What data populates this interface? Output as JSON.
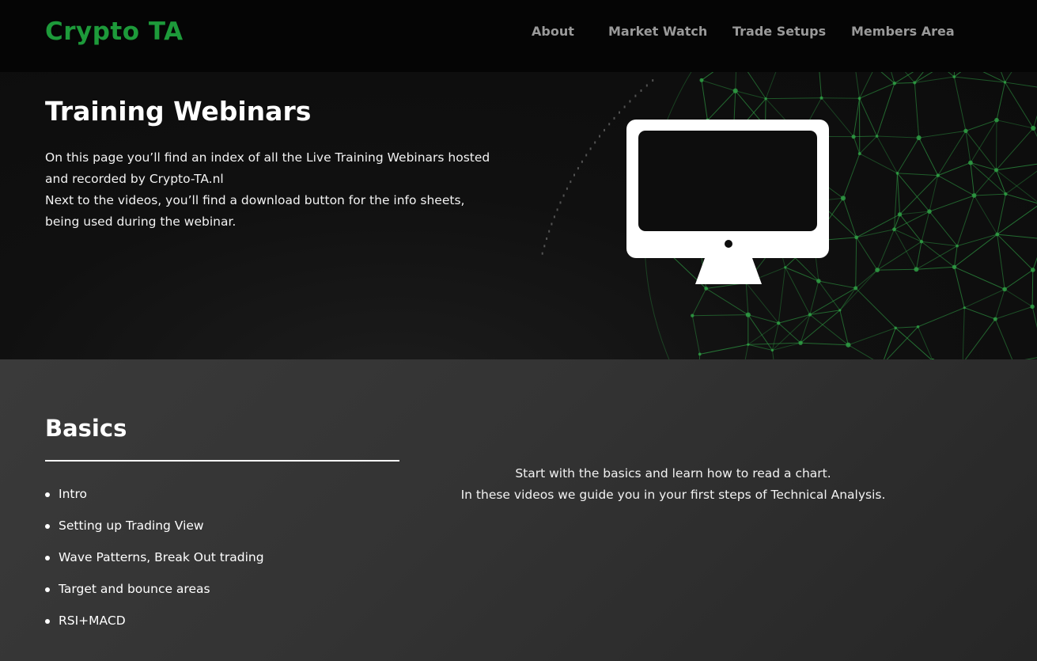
{
  "header": {
    "brand": "Crypto TA",
    "nav": [
      "About",
      "Market Watch",
      "Trade Setups",
      "Members Area"
    ]
  },
  "hero": {
    "title": "Training Webinars",
    "paragraph_1": "On this page you’ll find an index of all the Live Training Webinars hosted and recorded by Crypto-TA.nl",
    "paragraph_2": "Next to the videos, you’ll find a download button for the info sheets, being used during the webinar.",
    "icon": "monitor-icon",
    "background": "green-network-globe"
  },
  "basics": {
    "title": "Basics",
    "lessons": [
      "Intro",
      "Setting up Trading View",
      "Wave Patterns, Break Out trading",
      "Target and bounce areas",
      "RSI+MACD"
    ],
    "description_1": "Start with the basics and learn how to read a chart.",
    "description_2": "In these videos we guide you in your first steps of Technical Analysis."
  },
  "colors": {
    "brand_green": "#1d9a3a",
    "network_green": "#2f9e44",
    "nav_text": "#9a9a9a",
    "header_bg": "#050505",
    "hero_bg": "#0f0f0f",
    "section_bg": "#333333"
  }
}
